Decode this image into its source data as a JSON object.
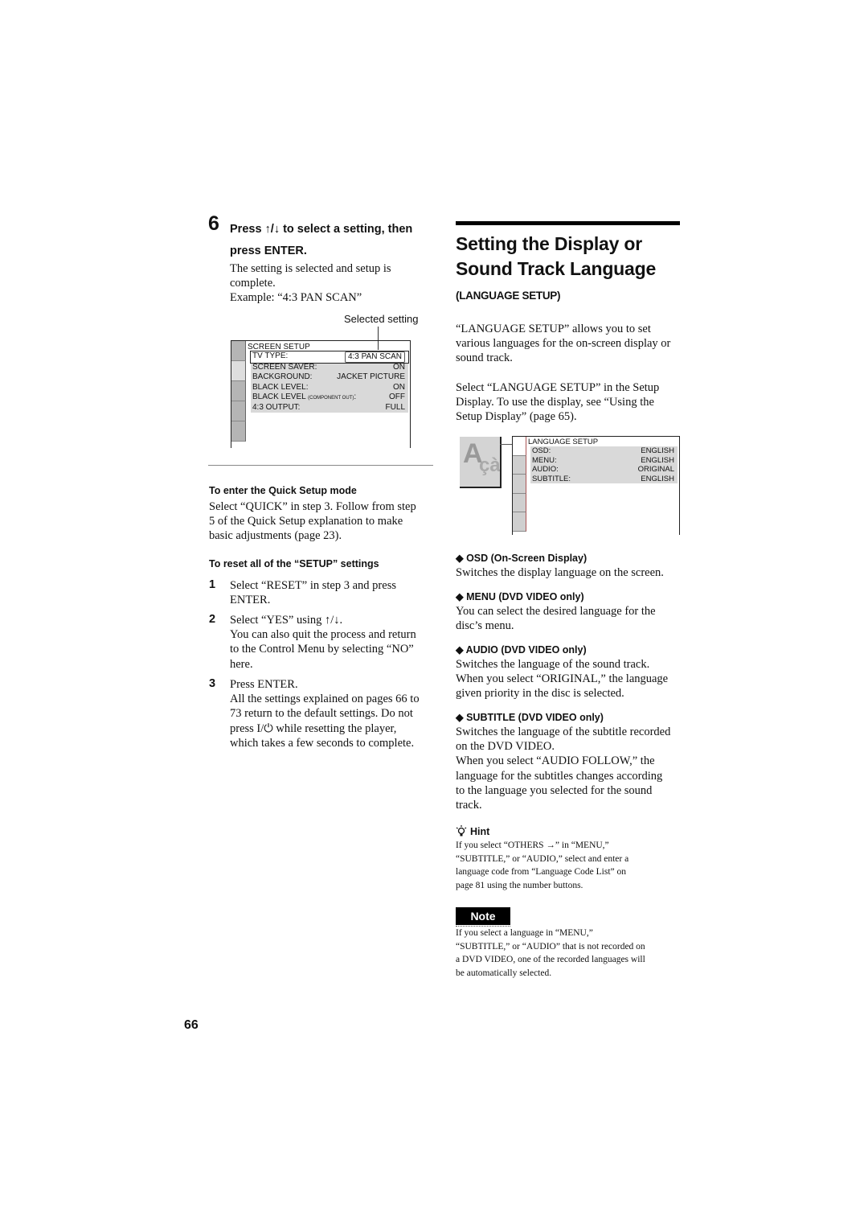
{
  "left": {
    "step6": {
      "number": "6",
      "heading_line1": "Press ↑/↓ to select a setting, then",
      "heading_line2": "press ENTER.",
      "body_line1": "The setting is selected and setup is",
      "body_line2": "complete.",
      "body_line3": "Example: “4:3 PAN SCAN”"
    },
    "callout_label": "Selected setting",
    "screen_setup_osd": {
      "title": "SCREEN SETUP",
      "rows": [
        {
          "label": "TV TYPE:",
          "value": "4:3 PAN SCAN",
          "selected": true
        },
        {
          "label": "SCREEN SAVER:",
          "value": "ON"
        },
        {
          "label": "BACKGROUND:",
          "value": "JACKET PICTURE"
        },
        {
          "label": "BLACK LEVEL:",
          "value": "ON"
        },
        {
          "label": "BLACK LEVEL",
          "label_small": "(COMPONENT OUT)",
          "value": "OFF"
        },
        {
          "label": "4:3 OUTPUT:",
          "value": "FULL"
        }
      ]
    },
    "quick_setup": {
      "heading": "To enter the Quick Setup mode",
      "line1": "Select “QUICK” in step 3. Follow from step",
      "line2": "5 of the Quick Setup explanation to make",
      "line3": "basic adjustments (page 23)."
    },
    "reset": {
      "heading": "To reset all of the “SETUP” settings",
      "steps": [
        {
          "num": "1",
          "lines": [
            "Select “RESET” in step 3 and press",
            "ENTER."
          ]
        },
        {
          "num": "2",
          "lines": [
            "Select “YES” using ↑/↓.",
            "You can also quit the process and return",
            "to the Control Menu by selecting “NO”",
            "here."
          ]
        },
        {
          "num": "3",
          "lines": [
            "Press ENTER.",
            "All the settings explained on pages 66 to",
            "73 return to the default settings. Do not",
            "press I/⏻ while resetting the player,",
            "which takes a few seconds to complete."
          ]
        }
      ]
    }
  },
  "right": {
    "title_line1": "Setting the Display or",
    "title_line2": "Sound Track Language",
    "subtitle": "(LANGUAGE SETUP)",
    "intro": [
      "“LANGUAGE SETUP” allows you to set",
      "various languages for the on-screen display or",
      "sound track."
    ],
    "intro2": [
      "Select “LANGUAGE SETUP” in the Setup",
      "Display. To use the display, see “Using the",
      "Setup Display” (page 65)."
    ],
    "icon_big": "A",
    "icon_small": "çà",
    "language_osd": {
      "title": "LANGUAGE SETUP",
      "rows": [
        {
          "label": "OSD:",
          "value": "ENGLISH"
        },
        {
          "label": "MENU:",
          "value": "ENGLISH"
        },
        {
          "label": "AUDIO:",
          "value": "ORIGINAL"
        },
        {
          "label": "SUBTITLE:",
          "value": "ENGLISH"
        }
      ]
    },
    "items": [
      {
        "head": "◆ OSD (On-Screen Display)",
        "lines": [
          "Switches the display language on the screen."
        ]
      },
      {
        "head": "◆ MENU (DVD VIDEO only)",
        "lines": [
          "You can select the desired language for the",
          "disc’s menu."
        ]
      },
      {
        "head": "◆ AUDIO (DVD VIDEO only)",
        "lines": [
          "Switches the language of the sound track.",
          "When you select “ORIGINAL,” the language",
          "given priority in the disc is selected."
        ]
      },
      {
        "head": "◆ SUBTITLE (DVD VIDEO only)",
        "lines": [
          "Switches the language of the subtitle recorded",
          "on the DVD VIDEO.",
          "When you select “AUDIO FOLLOW,” the",
          "language for the subtitles changes according",
          "to the language you selected for the sound",
          "track."
        ]
      }
    ],
    "hint": {
      "icon": "lightbulb-icon",
      "label": "Hint",
      "lines": [
        "If you select “OTHERS →” in “MENU,”",
        "“SUBTITLE,” or “AUDIO,” select and enter a",
        "language code from “Language Code List” on",
        "page 81 using the number buttons."
      ]
    },
    "note": {
      "label": "Note",
      "lines": [
        "If you select a language in “MENU,”",
        "“SUBTITLE,” or “AUDIO” that is not recorded on",
        "a DVD VIDEO, one of the recorded languages will",
        "be automatically selected."
      ]
    }
  },
  "page_number": "66"
}
